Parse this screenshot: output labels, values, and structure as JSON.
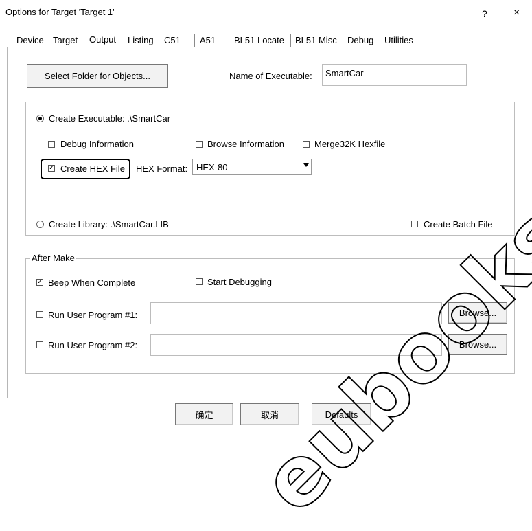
{
  "window": {
    "title": "Options for Target 'Target 1'",
    "help": "?",
    "close": "×"
  },
  "tabs": [
    "Device",
    "Target",
    "Output",
    "Listing",
    "C51",
    "A51",
    "BL51 Locate",
    "BL51 Misc",
    "Debug",
    "Utilities"
  ],
  "active_tab": "Output",
  "output": {
    "select_folder_label": "Select Folder for Objects...",
    "name_of_executable_label": "Name of Executable:",
    "name_of_executable_value": "SmartCar",
    "create_executable_label": "Create Executable:  .\\SmartCar",
    "debug_information_label": "Debug Information",
    "browse_information_label": "Browse Information",
    "merge32k_label": "Merge32K Hexfile",
    "create_hex_label": "Create HEX File",
    "hex_format_label": "HEX Format:",
    "hex_format_value": "HEX-80",
    "create_library_label": "Create Library:  .\\SmartCar.LIB",
    "create_batch_label": "Create Batch File"
  },
  "after_make": {
    "legend": "After Make",
    "beep_label": "Beep When Complete",
    "start_debugging_label": "Start Debugging",
    "run1_label": "Run User Program #1:",
    "run2_label": "Run User Program #2:",
    "run1_value": "",
    "run2_value": "",
    "browse_label": "Browse..."
  },
  "buttons": {
    "ok": "确定",
    "cancel": "取消",
    "defaults": "Defaults"
  },
  "watermark": "eubooks"
}
